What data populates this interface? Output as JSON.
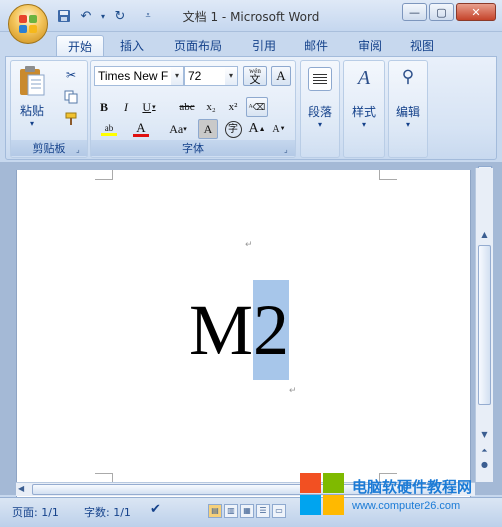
{
  "window": {
    "title": "文档 1 - Microsoft Word"
  },
  "window_controls": {
    "minimize": "—",
    "maximize": "▢",
    "close": "✕"
  },
  "tabs": [
    {
      "label": "开始",
      "active": true
    },
    {
      "label": "插入"
    },
    {
      "label": "页面布局"
    },
    {
      "label": "引用"
    },
    {
      "label": "邮件"
    },
    {
      "label": "审阅"
    },
    {
      "label": "视图"
    }
  ],
  "clipboard": {
    "paste_label": "粘贴",
    "group_label": "剪贴板"
  },
  "font_group": {
    "font_name": "Times New F",
    "font_size": "72",
    "group_label": "字体",
    "bold": "B",
    "italic": "I",
    "underline": "U",
    "strike": "abc",
    "subscript": "x₂",
    "superscript": "x²",
    "grow": "A",
    "shrink": "A",
    "change_case": "Aa",
    "char_shade": "A",
    "enclose": "字",
    "wen": "wén",
    "wen_char": "文",
    "font_color": "A",
    "highlight": "ab"
  },
  "paragraph": {
    "label": "段落"
  },
  "styles": {
    "label": "样式"
  },
  "editing": {
    "label": "编辑"
  },
  "document": {
    "text_main": "M",
    "text_selected": "2",
    "para_mark": "↵"
  },
  "status": {
    "page": "页面: 1/1",
    "words": "字数: 1/1"
  },
  "watermark": {
    "line1": "电脑软硬件教程网",
    "line2": "www.computer26.com"
  },
  "colors": {
    "accent": "#15428b",
    "selection": "#a7c6ea",
    "font_color_bar": "#e01010",
    "highlight_bar": "#ffff00"
  }
}
